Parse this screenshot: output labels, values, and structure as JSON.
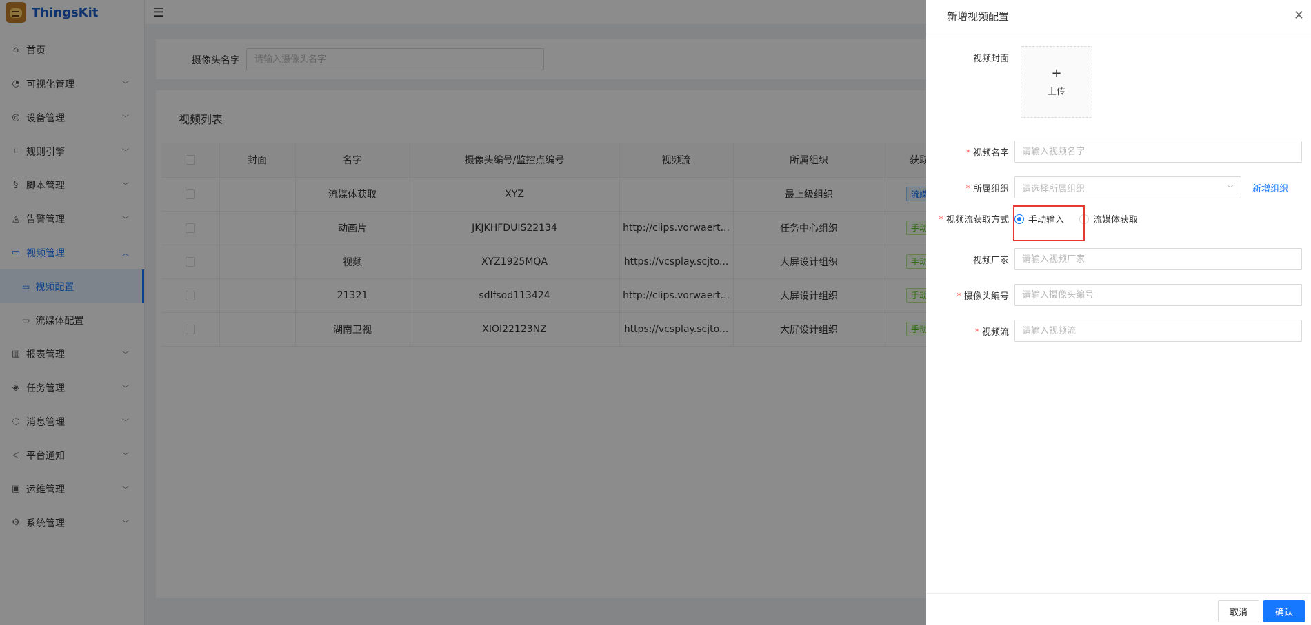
{
  "app": {
    "title": "ThingsKit"
  },
  "sidebar": {
    "items": [
      {
        "label": "首页",
        "icon": "home-icon"
      },
      {
        "label": "可视化管理",
        "icon": "dashboard-icon"
      },
      {
        "label": "设备管理",
        "icon": "device-icon"
      },
      {
        "label": "规则引擎",
        "icon": "rule-icon"
      },
      {
        "label": "脚本管理",
        "icon": "script-icon"
      },
      {
        "label": "告警管理",
        "icon": "alarm-icon"
      },
      {
        "label": "视频管理",
        "icon": "video-icon",
        "open": true,
        "children": [
          {
            "label": "视频配置",
            "active": true
          },
          {
            "label": "流媒体配置"
          }
        ]
      },
      {
        "label": "报表管理",
        "icon": "chart-icon"
      },
      {
        "label": "任务管理",
        "icon": "task-icon"
      },
      {
        "label": "消息管理",
        "icon": "message-icon"
      },
      {
        "label": "平台通知",
        "icon": "notice-icon"
      },
      {
        "label": "运维管理",
        "icon": "ops-icon"
      },
      {
        "label": "系统管理",
        "icon": "settings-icon"
      }
    ]
  },
  "search": {
    "label": "摄像头名字",
    "placeholder": "请输入摄像头名字"
  },
  "table": {
    "title": "视频列表",
    "columns": [
      "封面",
      "名字",
      "摄像头编号/监控点编号",
      "视频流",
      "所属组织",
      "获取"
    ],
    "rows": [
      {
        "name": "流媒体获取",
        "code": "XYZ",
        "stream": "",
        "org": "最上级组织",
        "tag": "流媒",
        "tag_color": "blue"
      },
      {
        "name": "动画片",
        "code": "JKJKHFDUIS22134",
        "stream": "http://clips.vorwaert...",
        "org": "任务中心组织",
        "tag": "手动",
        "tag_color": "green"
      },
      {
        "name": "视频",
        "code": "XYZ1925MQA",
        "stream": "https://vcsplay.scjto...",
        "org": "大屏设计组织",
        "tag": "手动",
        "tag_color": "green"
      },
      {
        "name": "21321",
        "code": "sdlfsod113424",
        "stream": "http://clips.vorwaert...",
        "org": "大屏设计组织",
        "tag": "手动",
        "tag_color": "green"
      },
      {
        "name": "湖南卫视",
        "code": "XIOI22123NZ",
        "stream": "https://vcsplay.scjto...",
        "org": "大屏设计组织",
        "tag": "手动",
        "tag_color": "green"
      }
    ]
  },
  "drawer": {
    "title": "新增视频配置",
    "cover_label": "视频封面",
    "upload_text": "上传",
    "name_label": "视频名字",
    "name_placeholder": "请输入视频名字",
    "org_label": "所属组织",
    "org_placeholder": "请选择所属组织",
    "new_org_link": "新增组织",
    "method_label": "视频流获取方式",
    "method_options": [
      "手动输入",
      "流媒体获取"
    ],
    "method_selected": "手动输入",
    "vendor_label": "视频厂家",
    "vendor_placeholder": "请输入视频厂家",
    "camera_label": "摄像头编号",
    "camera_placeholder": "请输入摄像头编号",
    "stream_label": "视频流",
    "stream_placeholder": "请输入视频流",
    "cancel_label": "取消",
    "ok_label": "确认"
  },
  "colors": {
    "primary": "#1677ff",
    "highlight": "#e53935",
    "required": "#ff4d4f"
  }
}
